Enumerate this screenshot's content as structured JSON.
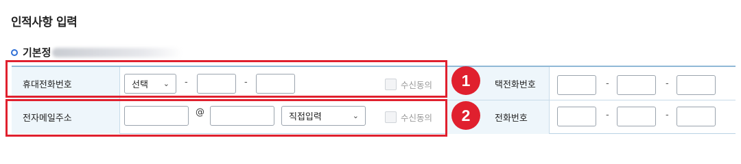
{
  "page": {
    "title": "인적사항 입력"
  },
  "section": {
    "title": "기본정"
  },
  "rows": [
    {
      "left": {
        "label": "휴대전화번호",
        "select": {
          "value": "선택"
        },
        "separators": [
          "-",
          "-"
        ],
        "consent": "수신동의"
      },
      "right": {
        "label": "자택전화번호",
        "visible_label": "택전화번호",
        "separators": [
          "-",
          "-"
        ]
      }
    },
    {
      "left": {
        "label": "전자메일주소",
        "at_symbol": "@",
        "domain_select": {
          "value": "직접입력"
        },
        "consent": "수신동의"
      },
      "right": {
        "label": "직장전화번호",
        "visible_label": "전화번호",
        "separators": [
          "-",
          "-"
        ]
      }
    }
  ],
  "annotations": [
    {
      "number": "1",
      "color": "#e0202e"
    },
    {
      "number": "2",
      "color": "#e0202e"
    }
  ],
  "icons": {
    "dropdown": "chevron-down-icon",
    "bullet": "circle-bullet-icon"
  },
  "colors": {
    "accent": "#e0202e",
    "label_bg": "#eef6fb",
    "border": "#8fb8d6",
    "bullet": "#2f6fd6"
  }
}
